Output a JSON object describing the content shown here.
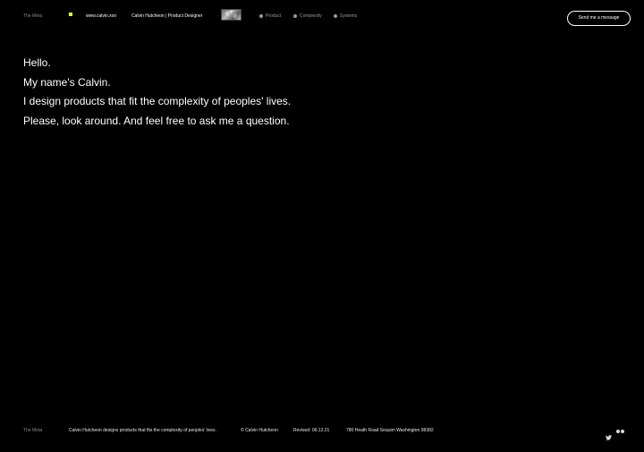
{
  "header": {
    "meta_label": "The Meta",
    "site_url": "www.calvin.xoo",
    "site_name": "Calvin Hutcheon | Product Designer",
    "nav": [
      {
        "label": "Product"
      },
      {
        "label": "Complexity"
      },
      {
        "label": "Systems"
      }
    ],
    "send_button": "Send me a message"
  },
  "intro": {
    "lines": [
      "Hello.",
      "My name's Calvin.",
      "I design products that fit the complexity of peoples' lives.",
      "Please, look around. And feel free to ask me a question."
    ]
  },
  "footer": {
    "meta_label": "The Meta",
    "description": "Calvin Hutcheon designs products that fits the complexity of peoples' lives.",
    "copyright": "© Calvin Hutcheon",
    "revised": "Revised: 06.12.21",
    "address": "780 Heath Road Sequim Washington 98382",
    "icons": [
      "twitter-icon",
      "flickr-icon"
    ]
  },
  "colors": {
    "background": "#000000",
    "text": "#ffffff",
    "muted": "#8a8a8a",
    "accent": "#e8ff2a"
  }
}
